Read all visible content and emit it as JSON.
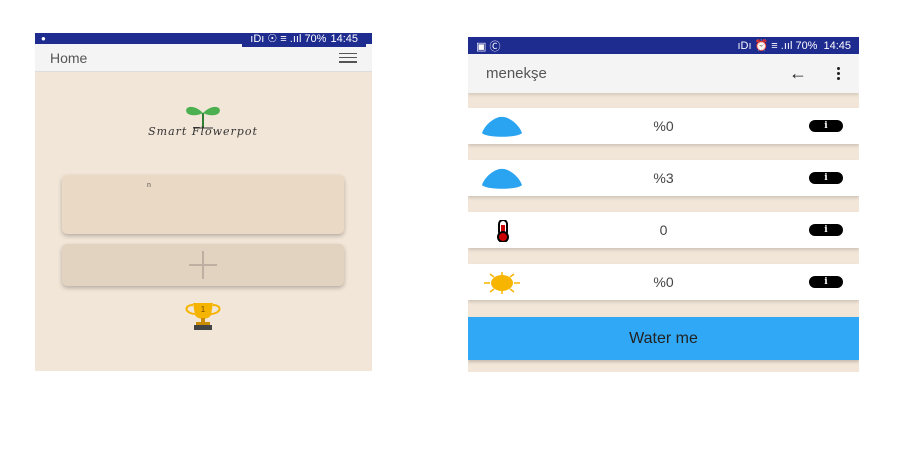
{
  "left": {
    "status_bar": {
      "left_icon": "app-icon",
      "right_text": "ıDı ☉ ≡ .ııl 70%",
      "time": "14:45"
    },
    "app_bar": {
      "title": "Home",
      "menu_icon": "hamburger-menu-icon"
    },
    "logo_text": "Smart Flowerpot",
    "plant_card": {
      "name": "n"
    },
    "add_card": {
      "icon": "plus-icon"
    },
    "trophy": {
      "icon": "trophy-icon",
      "rank": "1"
    }
  },
  "right": {
    "status_bar": {
      "left_text": "▣ Ⓒ",
      "right_text": "ıDı ⏰ ≡ .ııl 70%",
      "time": "14:45"
    },
    "app_bar": {
      "title": "menekşe",
      "back_icon": "back-arrow-icon",
      "more_icon": "more-vert-icon"
    },
    "readings": [
      {
        "icon": "water-drop-icon",
        "value": "%0"
      },
      {
        "icon": "water-drop-icon",
        "value": "%3"
      },
      {
        "icon": "thermometer-icon",
        "value": "0"
      },
      {
        "icon": "sun-icon",
        "value": "%0"
      }
    ],
    "info_label": "i",
    "water_button": "Water me"
  },
  "colors": {
    "status_bar": "#1e2b8f",
    "background": "#f2e6d8",
    "button": "#30a8f5",
    "drop": "#2aa3f0"
  }
}
